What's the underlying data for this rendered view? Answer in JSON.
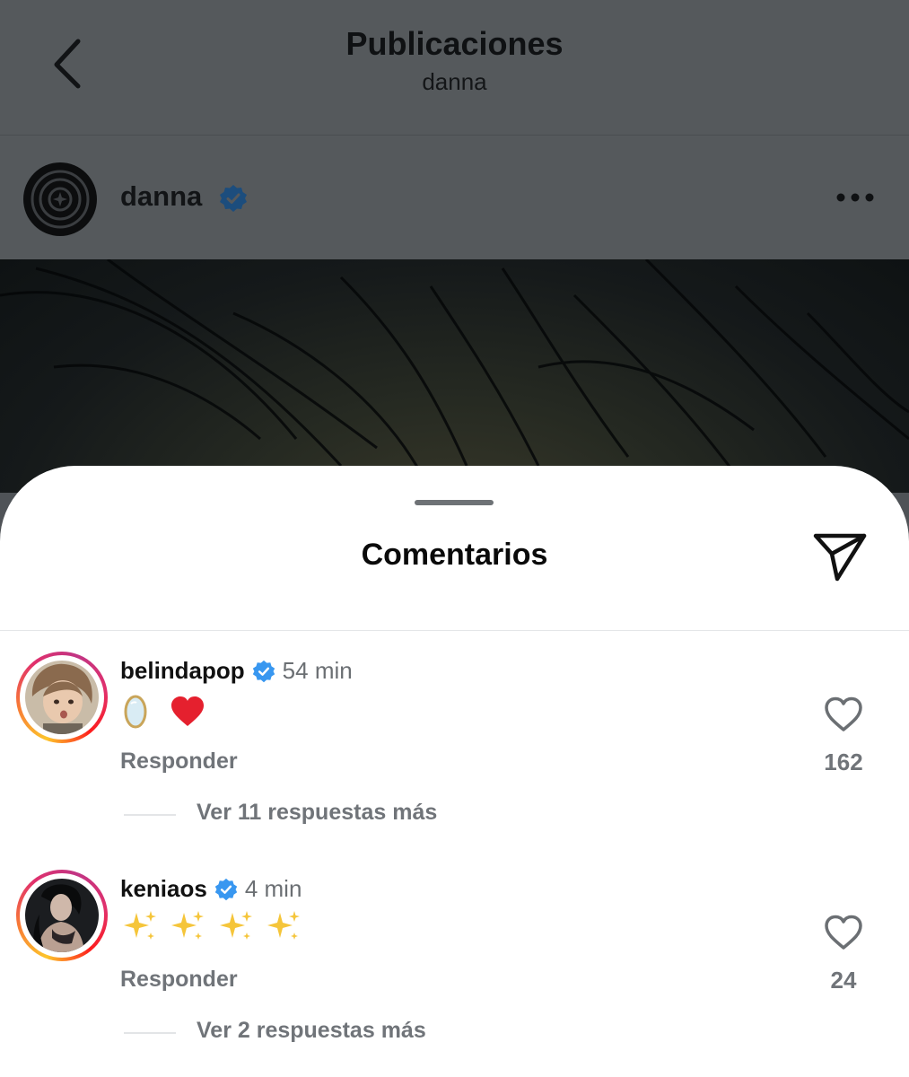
{
  "header": {
    "title": "Publicaciones",
    "subtitle": "danna"
  },
  "post": {
    "username": "danna",
    "verified": true
  },
  "comments_sheet": {
    "title": "Comentarios",
    "comments": [
      {
        "username": "belindapop",
        "verified": true,
        "time": "54 min",
        "text_emojis": [
          "mirror",
          "red-heart"
        ],
        "reply_label": "Responder",
        "like_count": "162",
        "more_replies": "Ver 11 respuestas más"
      },
      {
        "username": "keniaos",
        "verified": true,
        "time": "4 min",
        "text_emojis": [
          "sparkles",
          "sparkles",
          "sparkles",
          "sparkles"
        ],
        "reply_label": "Responder",
        "like_count": "24",
        "more_replies": "Ver 2 respuestas más"
      }
    ]
  },
  "colors": {
    "verified_blue": "#3897f0",
    "dim_overlay": "#55595c",
    "secondary_text": "#707479"
  },
  "icons": [
    "back-chevron-icon",
    "verified-badge-icon",
    "more-options-icon",
    "share-icon",
    "heart-outline-icon"
  ]
}
